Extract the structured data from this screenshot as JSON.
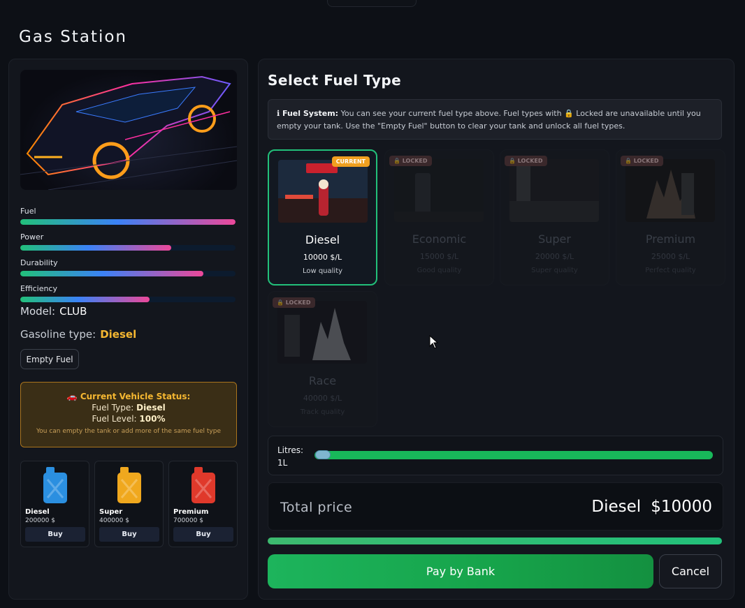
{
  "app": {
    "title": "Gas Station"
  },
  "left": {
    "stats": [
      {
        "label": "Fuel",
        "fraction": 1.0
      },
      {
        "label": "Power",
        "fraction": 0.7
      },
      {
        "label": "Durability",
        "fraction": 0.85
      },
      {
        "label": "Efficiency",
        "fraction": 0.6
      }
    ],
    "model_label": "Model:",
    "model_value": "CLUB",
    "gas_label": "Gasoline type:",
    "gas_value": "Diesel",
    "empty_fuel_label": "Empty Fuel",
    "status": {
      "header": "🚗 Current Vehicle Status:",
      "fuel_type_label": "Fuel Type:",
      "fuel_type_value": "Diesel",
      "fuel_level_label": "Fuel Level:",
      "fuel_level_value": "100%",
      "note": "You can empty the tank or add more of the same fuel type"
    },
    "cans": [
      {
        "name": "Diesel",
        "price": "200000 $",
        "buy": "Buy",
        "color": "#2b8fe0"
      },
      {
        "name": "Super",
        "price": "400000 $",
        "buy": "Buy",
        "color": "#f0a81e"
      },
      {
        "name": "Premium",
        "price": "700000 $",
        "buy": "Buy",
        "color": "#e0392b"
      }
    ]
  },
  "right": {
    "title": "Select Fuel Type",
    "info_prefix": "ℹ Fuel System:",
    "info_text": "You can see your current fuel type above. Fuel types with 🔒 Locked are unavailable until you empty your tank. Use the \"Empty Fuel\" button to clear your tank and unlock all fuel types.",
    "fuels": [
      {
        "name": "Diesel",
        "price": "10000 $/L",
        "quality": "Low quality",
        "badge": "CURRENT",
        "state": "current"
      },
      {
        "name": "Economic",
        "price": "15000 $/L",
        "quality": "Good quality",
        "badge": "🔒 LOCKED",
        "state": "locked"
      },
      {
        "name": "Super",
        "price": "20000 $/L",
        "quality": "Super quality",
        "badge": "🔒 LOCKED",
        "state": "locked"
      },
      {
        "name": "Premium",
        "price": "25000 $/L",
        "quality": "Perfect quality",
        "badge": "🔒 LOCKED",
        "state": "locked"
      },
      {
        "name": "Race",
        "price": "40000 $/L",
        "quality": "Track quality",
        "badge": "🔒 LOCKED",
        "state": "locked"
      }
    ],
    "litres_label": "Litres:",
    "litres_value": "1L",
    "total_label": "Total price",
    "total_fuel": "Diesel",
    "total_price": "$10000",
    "pay_label": "Pay by Bank",
    "cancel_label": "Cancel"
  },
  "colors": {
    "accent_green": "#22c07a",
    "current_badge": "#f0a020",
    "gold": "#f5b731"
  }
}
